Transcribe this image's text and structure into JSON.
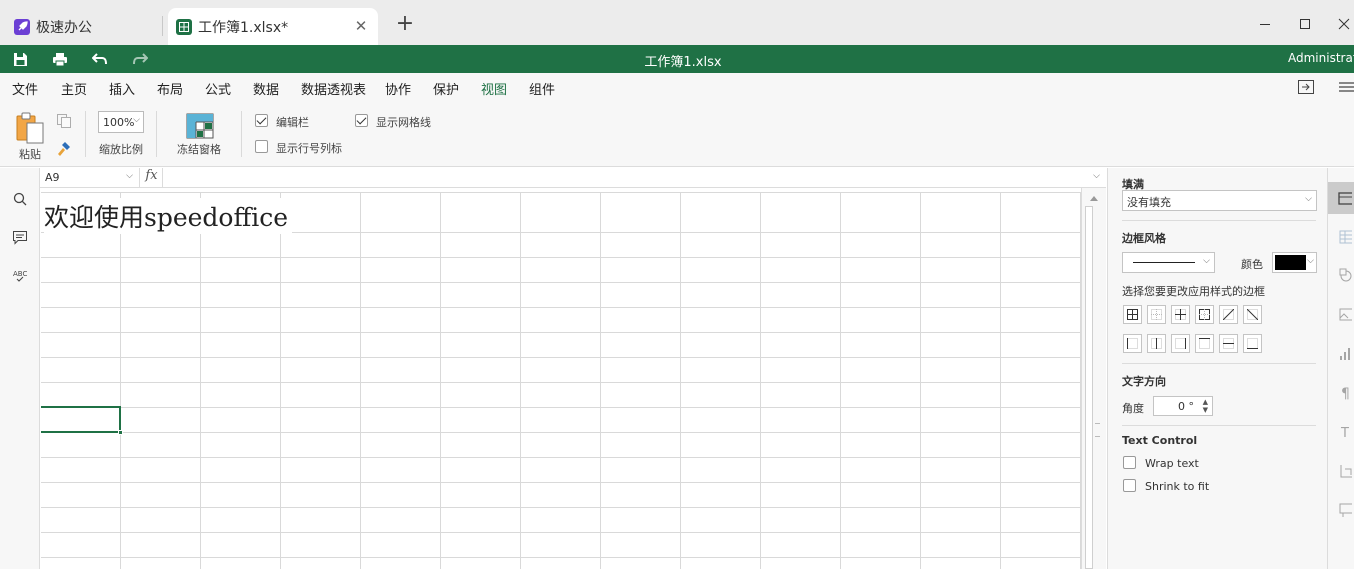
{
  "tabs": [
    {
      "label": "极速办公",
      "icon": "rocket-icon"
    },
    {
      "label": "工作簿1.xlsx*",
      "icon": "spreadsheet-icon",
      "close": "✕"
    }
  ],
  "new_tab": "+",
  "titlebar": {
    "title": "工作簿1.xlsx",
    "user": "Administrator"
  },
  "menu": [
    "文件",
    "主页",
    "插入",
    "布局",
    "公式",
    "数据",
    "数据透视表",
    "协作",
    "保护",
    "视图",
    "组件"
  ],
  "active_menu": "视图",
  "ribbon": {
    "paste": "粘贴",
    "zoom_value": "100%",
    "zoom_label": "缩放比例",
    "freeze": "冻结窗格",
    "formula_bar_cb": {
      "label": "编辑栏",
      "checked": true
    },
    "gridlines_cb": {
      "label": "显示网格线",
      "checked": true
    },
    "headings_cb": {
      "label": "显示行号列标",
      "checked": false
    }
  },
  "formula_bar": {
    "name_box": "A9",
    "fx": "fx",
    "value": ""
  },
  "sheet": {
    "a1_text": "欢迎使用speedoffice",
    "selected_cell": "A9"
  },
  "right_panel": {
    "fill_title": "填满",
    "fill_value": "没有填充",
    "border_style_title": "边框风格",
    "color_label": "颜色",
    "border_color": "#000000",
    "border_hint": "选择您要更改应用样式的边框",
    "text_direction_title": "文字方向",
    "angle_label": "角度",
    "angle_value": "0 °",
    "text_control_title": "Text Control",
    "wrap_text": "Wrap text",
    "shrink_to_fit": "Shrink to fit"
  },
  "colors": {
    "accent": "#1f7145",
    "rocket": "#6b3fd4"
  }
}
